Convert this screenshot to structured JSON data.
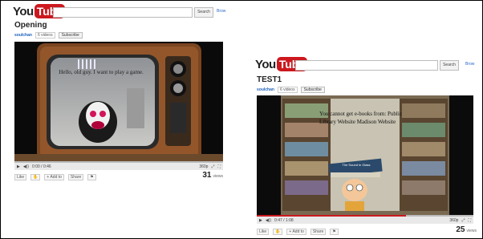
{
  "left": {
    "logo": {
      "you": "You",
      "tube": "Tube"
    },
    "search_button": "Search",
    "browse": "Brow",
    "title": "Opening",
    "channel": "soulchan",
    "video_count": "6 videos",
    "subscribe": "Subscribe",
    "speech": "Hello, old guy. I want to play a game.",
    "controls": {
      "play": "▶",
      "volume": "◀))",
      "time": "0:00 / 0:46",
      "quality": "360p"
    },
    "actions": {
      "like": "Like",
      "add": "+ Add to",
      "share": "Share"
    },
    "views": "31",
    "views_label": "views"
  },
  "right": {
    "logo": {
      "you": "You",
      "tube": "Tube"
    },
    "search_button": "Search",
    "browse": "Brow",
    "title": "TEST1",
    "channel": "soulchan",
    "video_count": "6 videos",
    "subscribe": "Subscribe",
    "slide_text": "You cannot get e-books from: Public Library Website Madison Website",
    "book_label": "The Sound in Glass",
    "controls": {
      "play": "▶",
      "volume": "◀))",
      "time": "0:47 / 1:08",
      "quality": "360p"
    },
    "actions": {
      "like": "Like",
      "add": "+ Add to",
      "share": "Share"
    },
    "views": "25",
    "views_label": "views"
  },
  "progress": {
    "left": 0.0,
    "right": 0.69
  },
  "colors": {
    "youtube_red": "#cc181e",
    "link_blue": "#1b5fbf"
  }
}
